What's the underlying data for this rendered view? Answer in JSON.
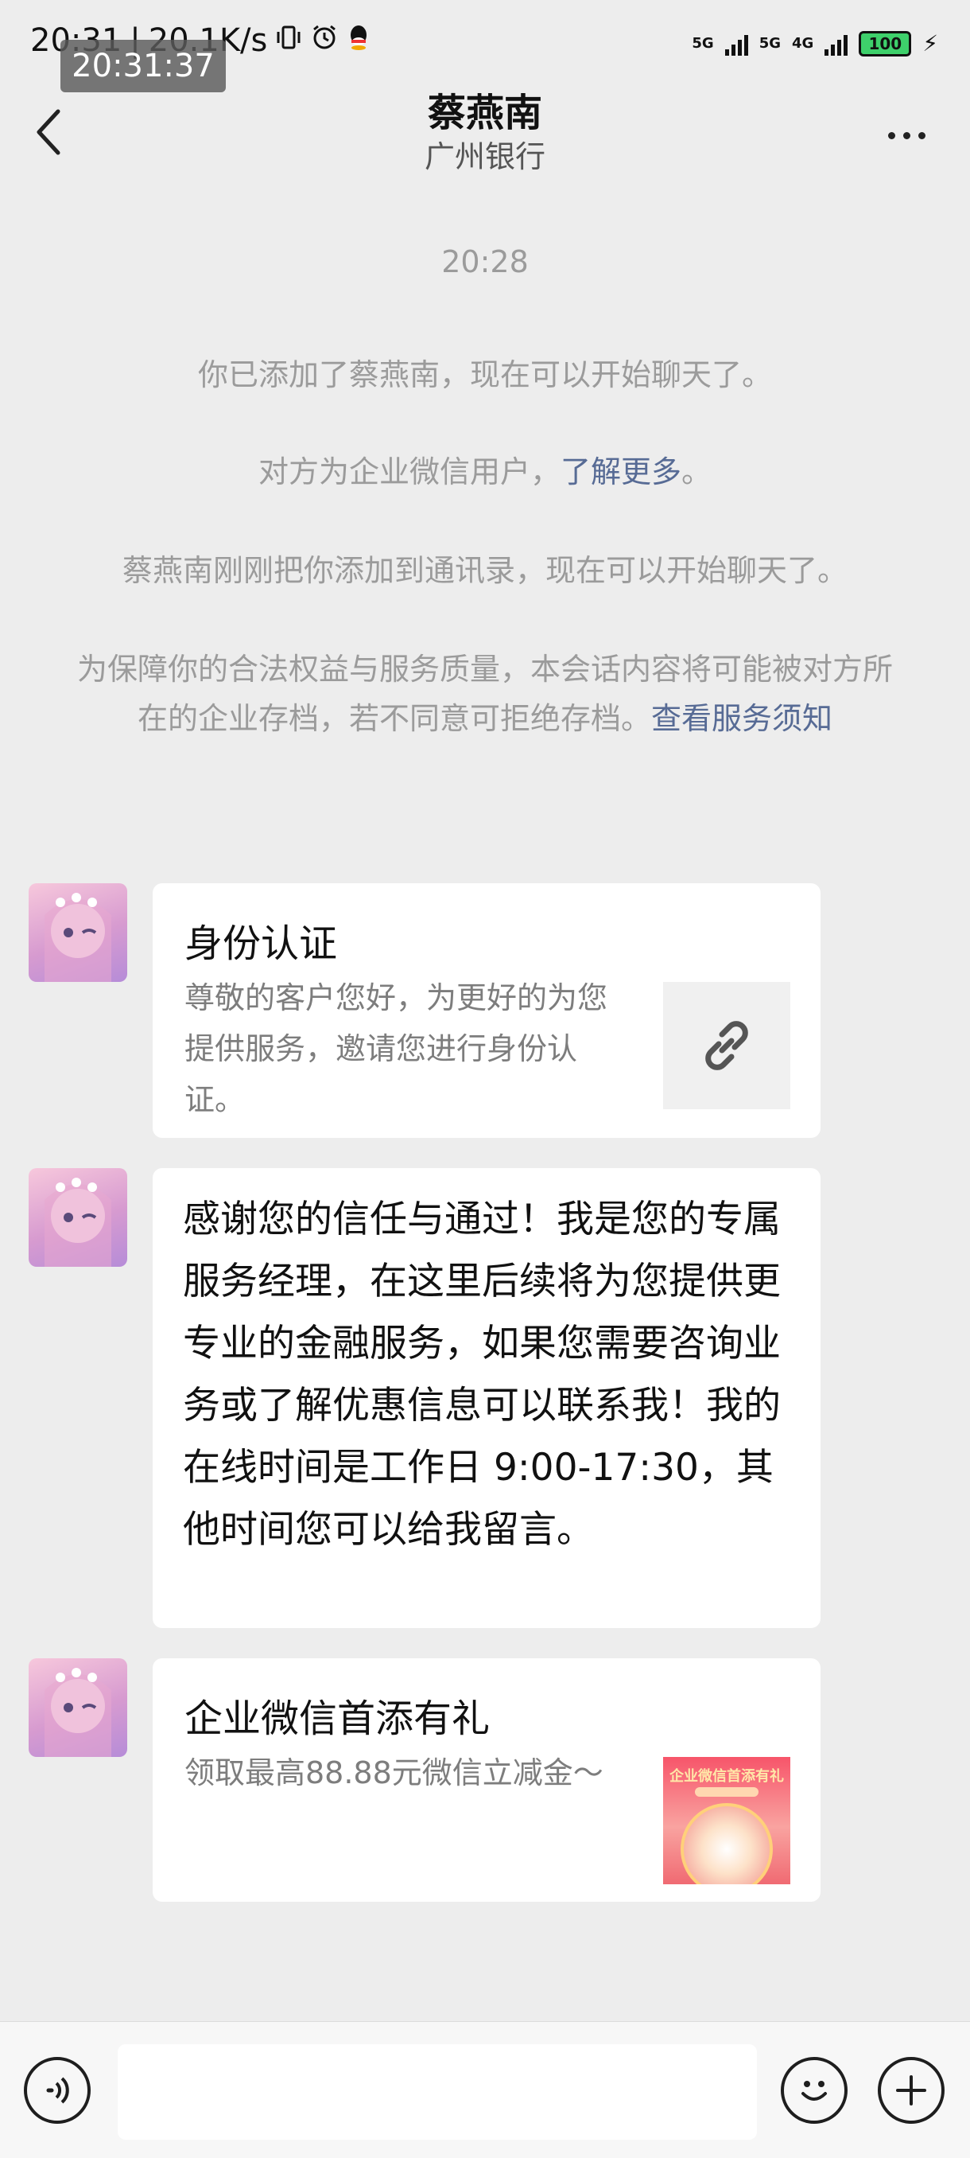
{
  "status_bar": {
    "time": "20:31",
    "speed": "20.1K/s",
    "overlay_time": "20:31:37",
    "net1": "5G",
    "net2": "5G",
    "net_type": "4G",
    "battery": "100",
    "icons": [
      "vibrate-icon",
      "alarm-icon",
      "qq-icon",
      "signal-icon",
      "battery-icon",
      "charging-icon"
    ]
  },
  "nav": {
    "title": "蔡燕南",
    "subtitle": "广州银行",
    "back_icon": "chevron-left-icon",
    "more_icon": "more-dots-icon"
  },
  "system_messages": {
    "timestamp": "20:28",
    "added": "你已添加了蔡燕南，现在可以开始聊天了。",
    "enterprise_prefix": "对方为企业微信用户，",
    "enterprise_link": "了解更多",
    "enterprise_suffix": "。",
    "contact_added": "蔡燕南刚刚把你添加到通讯录，现在可以开始聊天了。",
    "archive_text": "为保障你的合法权益与服务质量，本会话内容将可能被对方所在的企业存档，若不同意可拒绝存档。",
    "archive_link": "查看服务须知"
  },
  "messages": [
    {
      "type": "link-card",
      "title": "身份认证",
      "description": "尊敬的客户您好，为更好的为您提供服务，邀请您进行身份认证。",
      "thumb_icon": "link-icon"
    },
    {
      "type": "text",
      "text": "感谢您的信任与通过！我是您的专属服务经理，在这里后续将为您提供更专业的金融服务，如果您需要咨询业务或了解优惠信息可以联系我！我的在线时间是工作日 9:00-17:30，其他时间您可以给我留言。"
    },
    {
      "type": "promo-card",
      "title": "企业微信首添有礼",
      "description": "领取最高88.88元微信立减金～",
      "thumb_title": "企业微信首添有礼"
    }
  ],
  "input_bar": {
    "voice_icon": "voice-icon",
    "emoji_icon": "emoji-icon",
    "plus_icon": "plus-icon",
    "placeholder": ""
  },
  "colors": {
    "background": "#ededed",
    "link": "#576b95",
    "system_text": "#9b9b9b",
    "bubble": "#ffffff"
  }
}
